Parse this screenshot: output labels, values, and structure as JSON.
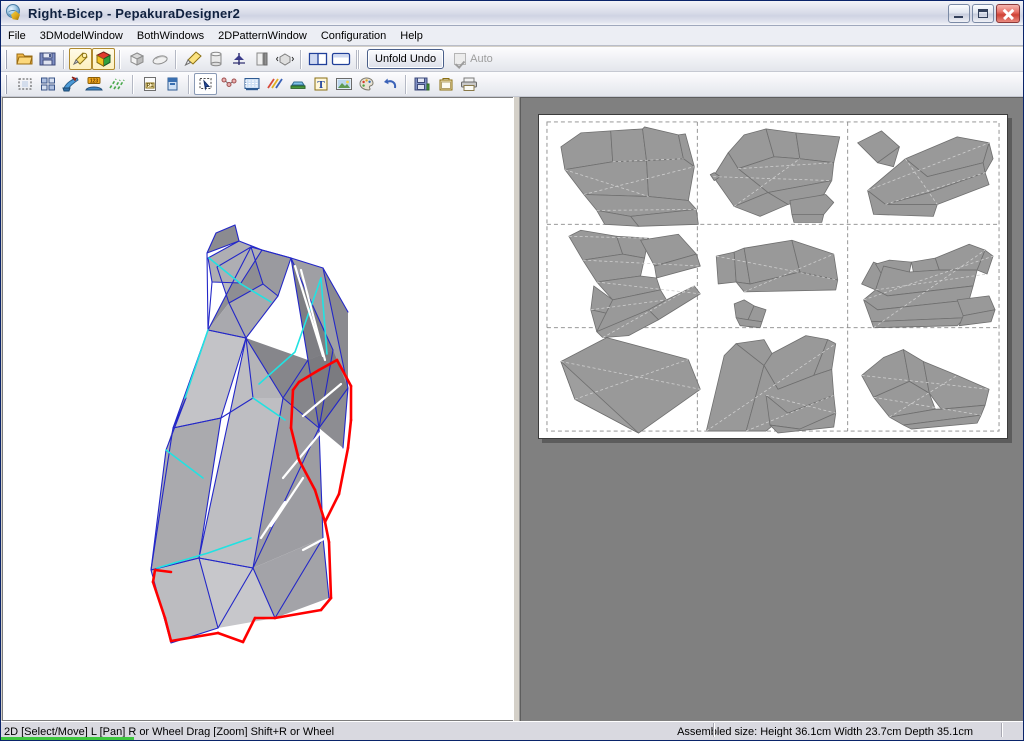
{
  "window": {
    "title": "Right-Bicep  -  PepakuraDesigner2",
    "icon": "pepakura-globe-icon",
    "buttons": {
      "minimize": "minimize-button",
      "maximize": "maximize-button",
      "close": "close-button"
    }
  },
  "menubar": {
    "items": [
      {
        "label": "File"
      },
      {
        "label": "3DModelWindow"
      },
      {
        "label": "BothWindows"
      },
      {
        "label": "2DPatternWindow"
      },
      {
        "label": "Configuration"
      },
      {
        "label": "Help"
      }
    ]
  },
  "toolbar1": {
    "tools": [
      {
        "name": "open-file-icon",
        "state": "normal"
      },
      {
        "name": "save-file-icon",
        "state": "normal"
      },
      {
        "name": "paint-texture-icon",
        "state": "active"
      },
      {
        "name": "color-cube-icon",
        "state": "active"
      },
      {
        "name": "shading-flat-icon",
        "state": "normal"
      },
      {
        "name": "shading-smooth-icon",
        "state": "normal"
      },
      {
        "name": "unfold-tool-icon",
        "state": "normal"
      },
      {
        "name": "cylinder-icon",
        "state": "normal"
      },
      {
        "name": "mirror-icon",
        "state": "normal"
      },
      {
        "name": "split-face-icon",
        "state": "normal"
      },
      {
        "name": "rotate-model-icon",
        "state": "normal"
      },
      {
        "name": "side-by-side-view-icon",
        "state": "normal"
      },
      {
        "name": "single-view-icon",
        "state": "normal"
      }
    ],
    "unfold_undo_label": "Unfold Undo",
    "auto_label": "Auto",
    "auto_checked": true,
    "auto_enabled": false
  },
  "toolbar2": {
    "tools": [
      {
        "name": "select-region-icon",
        "state": "normal"
      },
      {
        "name": "arrange-parts-icon",
        "state": "normal"
      },
      {
        "name": "paint-brush-icon",
        "state": "normal"
      },
      {
        "name": "number-tabs-icon",
        "state": "normal"
      },
      {
        "name": "edge-lines-icon",
        "state": "normal"
      },
      {
        "name": "page-number-icon",
        "state": "normal"
      },
      {
        "name": "flag-icon",
        "state": "normal"
      },
      {
        "name": "select-move-icon",
        "state": "pressed"
      },
      {
        "name": "join-faces-icon",
        "state": "normal"
      },
      {
        "name": "cut-line-icon",
        "state": "normal"
      },
      {
        "name": "fold-lines-icon",
        "state": "normal"
      },
      {
        "name": "flatten-icon",
        "state": "normal"
      },
      {
        "name": "add-text-icon",
        "state": "normal"
      },
      {
        "name": "add-image-icon",
        "state": "normal"
      },
      {
        "name": "texture-paint-icon",
        "state": "normal"
      },
      {
        "name": "undo-icon",
        "state": "normal"
      },
      {
        "name": "save-pattern-icon",
        "state": "normal"
      },
      {
        "name": "print-preview-icon",
        "state": "normal"
      },
      {
        "name": "print-icon",
        "state": "normal"
      }
    ]
  },
  "panel_3d": {
    "name": "3d-model-viewport",
    "background": "#ffffff",
    "edge_colors": {
      "fold": "#2222cc",
      "cut": "#ff0000",
      "selected": "#00e5e5",
      "highlight": "#ffffff"
    },
    "face_fill": "#b3b3b3"
  },
  "panel_2d": {
    "name": "2d-pattern-viewport",
    "background": "#808080",
    "page": {
      "background": "#ffffff",
      "grid_columns": 3,
      "grid_rows": 3,
      "divider_style": "dashed",
      "piece_fill": "#999999",
      "piece_outline": "#6d6d6d",
      "fold_line": "#cccccc",
      "piece_count": 15
    }
  },
  "statusbar": {
    "left": "2D [Select/Move] L [Pan] R or Wheel Drag [Zoom] Shift+R or Wheel",
    "right": "Assembled size: Height 36.1cm Width 23.7cm Depth 35.1cm",
    "progress_percent": 13,
    "progress_color": "#3ec63e"
  }
}
